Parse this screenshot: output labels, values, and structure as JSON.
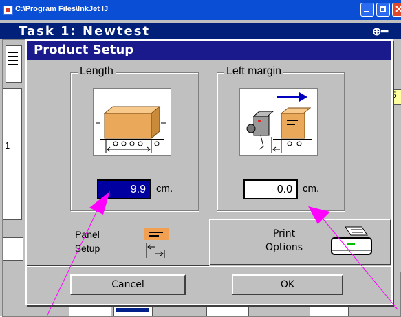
{
  "window": {
    "title": "C:\\Program Files\\InkJet  IJ"
  },
  "task": {
    "title": "Task 1: Newtest",
    "side_value": "5"
  },
  "dialog": {
    "title": "Product Setup",
    "length": {
      "label": "Length",
      "value": "9.9",
      "unit": "cm."
    },
    "left_margin": {
      "label": "Left margin",
      "value": "0.0",
      "unit": "cm."
    },
    "panel_setup": {
      "line1": "Panel",
      "line2": "Setup"
    },
    "print_options": {
      "line1": "Print",
      "line2": "Options"
    },
    "cancel_label": "Cancel",
    "ok_label": "OK"
  },
  "colors": {
    "title_blue": "#1a1a8c",
    "box_orange": "#f0a050",
    "annotation_magenta": "#ff00ff"
  }
}
